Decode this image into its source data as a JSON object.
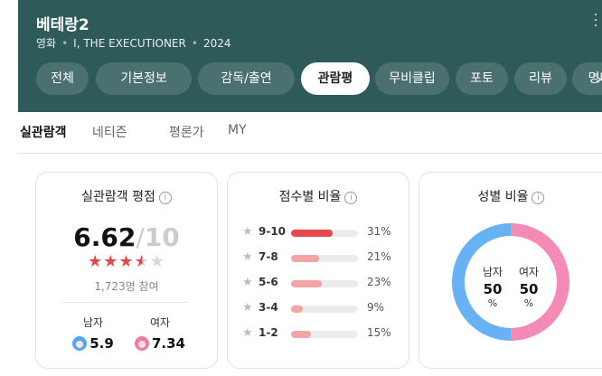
{
  "header": {
    "title": "베테랑2",
    "meta": [
      "영화",
      "I, THE EXECUTIONER",
      "2024"
    ],
    "more_icon": "more-vertical-icon"
  },
  "tabs": [
    {
      "label": "전체",
      "active": false
    },
    {
      "label": "기본정보",
      "active": false
    },
    {
      "label": "감독/출연",
      "active": false
    },
    {
      "label": "관람평",
      "active": true
    },
    {
      "label": "무비클립",
      "active": false
    },
    {
      "label": "포토",
      "active": false
    },
    {
      "label": "리뷰",
      "active": false
    },
    {
      "label": "명대사",
      "active": false
    }
  ],
  "subtabs": [
    {
      "label": "실관람객",
      "active": true
    },
    {
      "label": "네티즌",
      "active": false
    },
    {
      "label": "평론가",
      "active": false
    },
    {
      "label": "MY",
      "active": false
    }
  ],
  "rating": {
    "title": "실관람객 평점",
    "score": "6.62",
    "slash": "/",
    "out_of": "10",
    "stars_fill": 0.662,
    "participants": "1,723명 참여",
    "male_label": "남자",
    "male_score": "5.9",
    "female_label": "여자",
    "female_score": "7.34"
  },
  "distribution": {
    "title": "점수별 비율",
    "rows": [
      {
        "label": "9-10",
        "percent": "31%",
        "value": 31,
        "top": true
      },
      {
        "label": "7-8",
        "percent": "21%",
        "value": 21,
        "top": false
      },
      {
        "label": "5-6",
        "percent": "23%",
        "value": 23,
        "top": false
      },
      {
        "label": "3-4",
        "percent": "9%",
        "value": 9,
        "top": false
      },
      {
        "label": "1-2",
        "percent": "15%",
        "value": 15,
        "top": false
      }
    ]
  },
  "gender": {
    "title": "성별 비율",
    "male_label": "남자",
    "male_value": "50",
    "female_label": "여자",
    "female_value": "50",
    "unit": "%",
    "male_color": "#66b2f5",
    "female_color": "#f48bb6"
  },
  "colors": {
    "header_bg": "#2f5a5a",
    "accent_red": "#e5484d"
  }
}
